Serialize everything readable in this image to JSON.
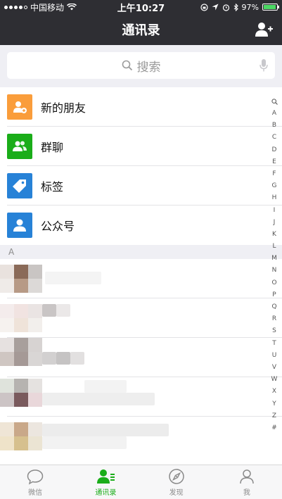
{
  "status": {
    "carrier": "中国移动",
    "time": "上午10:27",
    "battery": "97%"
  },
  "nav": {
    "title": "通讯录"
  },
  "search": {
    "placeholder": "搜索"
  },
  "functions": [
    {
      "label": "新的朋友",
      "color": "#fa9d3b"
    },
    {
      "label": "群聊",
      "color": "#1aad19"
    },
    {
      "label": "标签",
      "color": "#2782d7"
    },
    {
      "label": "公众号",
      "color": "#2782d7"
    }
  ],
  "section": {
    "letter": "A"
  },
  "index_letters": [
    "A",
    "B",
    "C",
    "D",
    "E",
    "F",
    "G",
    "H",
    "I",
    "J",
    "K",
    "L",
    "M",
    "N",
    "O",
    "P",
    "Q",
    "R",
    "S",
    "T",
    "U",
    "V",
    "W",
    "X",
    "Y",
    "Z",
    "#"
  ],
  "tabs": [
    {
      "label": "微信",
      "active": false
    },
    {
      "label": "通讯录",
      "active": true
    },
    {
      "label": "发现",
      "active": false
    },
    {
      "label": "我",
      "active": false
    }
  ],
  "colors": {
    "accent": "#1aad19",
    "nav_bg": "#2e2e33"
  }
}
